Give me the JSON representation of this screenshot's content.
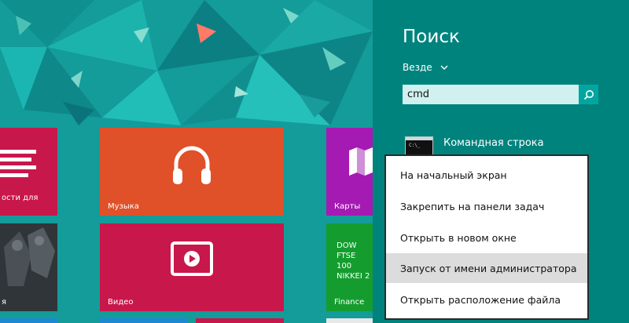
{
  "search_panel": {
    "title": "Поиск",
    "scope_label": "Везде",
    "query": "cmd",
    "result_label": "Командная строка",
    "result_icon_text": "C:\\_"
  },
  "context_menu": {
    "items": [
      {
        "label": "На начальный экран"
      },
      {
        "label": "Закрепить на панели задач"
      },
      {
        "label": "Открыть в новом окне"
      },
      {
        "label": "Запуск от имени администратора",
        "highlighted": true
      },
      {
        "label": "Открыть расположение файла"
      }
    ]
  },
  "start_screen": {
    "tiles": {
      "news_label": "ости для",
      "music_label": "Музыка",
      "maps_label": "Карты",
      "people_label": "я",
      "video_label": "Видео",
      "finance_label": "Finance",
      "finance_lines": [
        "DOW",
        "FTSE 100",
        "NIKKEI 2"
      ]
    }
  },
  "colors": {
    "background": "#139c99",
    "panel": "#00837d",
    "music_tile": "#e0512a",
    "news_tile": "#c8174b",
    "maps_tile": "#a51ab2",
    "video_tile": "#c8174b",
    "finance_tile": "#149d2e",
    "menu_highlight": "#dcdcdc"
  }
}
